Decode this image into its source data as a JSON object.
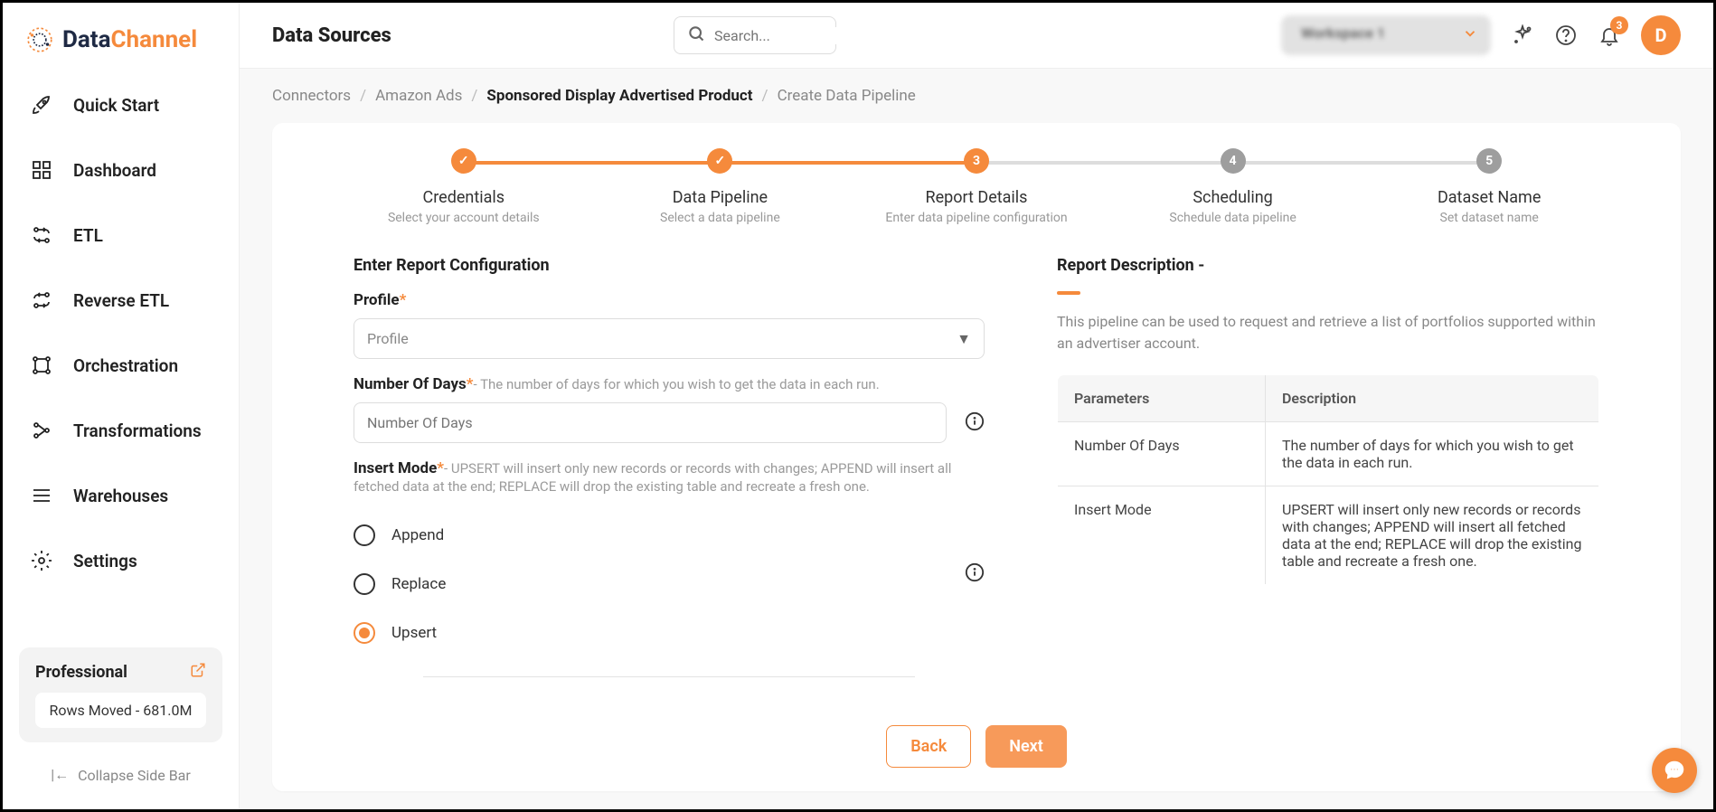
{
  "logo": {
    "text1": "Data",
    "text2": "Channel"
  },
  "nav": {
    "items": [
      {
        "icon": "rocket",
        "label": "Quick Start"
      },
      {
        "icon": "dashboard",
        "label": "Dashboard"
      },
      {
        "icon": "etl",
        "label": "ETL"
      },
      {
        "icon": "reverse",
        "label": "Reverse ETL"
      },
      {
        "icon": "orchestration",
        "label": "Orchestration"
      },
      {
        "icon": "transformations",
        "label": "Transformations"
      },
      {
        "icon": "warehouses",
        "label": "Warehouses"
      },
      {
        "icon": "settings",
        "label": "Settings"
      }
    ]
  },
  "plan": {
    "title": "Professional",
    "rows": "Rows Moved - 681.0M"
  },
  "collapse_label": "Collapse Side Bar",
  "header": {
    "title": "Data Sources",
    "search_placeholder": "Search...",
    "workspace": "Workspace 1",
    "notif_count": "3",
    "avatar": "D"
  },
  "breadcrumb": {
    "items": [
      "Connectors",
      "Amazon Ads",
      "Sponsored Display Advertised Product",
      "Create Data Pipeline"
    ],
    "bold_idx": 2
  },
  "stepper": [
    {
      "state": "done",
      "mark": "✓",
      "title": "Credentials",
      "sub": "Select your account details"
    },
    {
      "state": "done",
      "mark": "✓",
      "title": "Data Pipeline",
      "sub": "Select a data pipeline"
    },
    {
      "state": "active",
      "mark": "3",
      "title": "Report Details",
      "sub": "Enter data pipeline configuration"
    },
    {
      "state": "todo",
      "mark": "4",
      "title": "Scheduling",
      "sub": "Schedule data pipeline"
    },
    {
      "state": "todo",
      "mark": "5",
      "title": "Dataset Name",
      "sub": "Set dataset name"
    }
  ],
  "form": {
    "section_title": "Enter Report Configuration",
    "profile": {
      "label": "Profile",
      "placeholder": "Profile"
    },
    "days": {
      "label": "Number Of Days",
      "hint": "- The number of days for which you wish to get the data in each run.",
      "placeholder": "Number Of Days"
    },
    "insert": {
      "label": "Insert Mode",
      "hint": "- UPSERT will insert only new records or records with changes; APPEND will insert all fetched data at the end; REPLACE will drop the existing table and recreate a fresh one.",
      "options": [
        {
          "label": "Append",
          "selected": false
        },
        {
          "label": "Replace",
          "selected": false
        },
        {
          "label": "Upsert",
          "selected": true
        }
      ]
    }
  },
  "desc": {
    "title": "Report Description -",
    "text": "This pipeline can be used to request and retrieve a list of portfolios supported within an advertiser account.",
    "headers": {
      "param": "Parameters",
      "desc": "Description"
    },
    "rows": [
      {
        "p": "Number Of Days",
        "d": "The number of days for which you wish to get the data in each run."
      },
      {
        "p": "Insert Mode",
        "d": "UPSERT will insert only new records or records with changes; APPEND will insert all fetched data at the end; REPLACE will drop the existing table and recreate a fresh one."
      }
    ]
  },
  "buttons": {
    "back": "Back",
    "next": "Next"
  }
}
